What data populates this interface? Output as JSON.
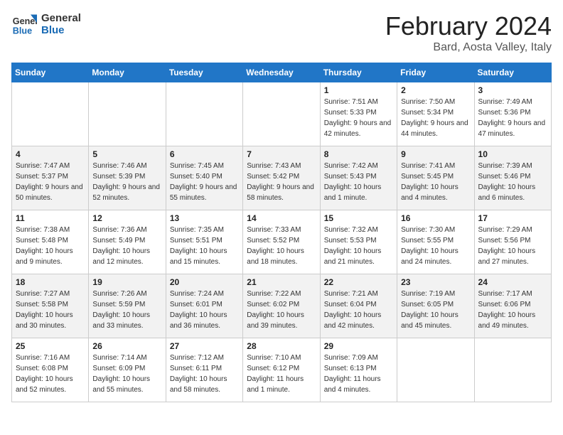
{
  "header": {
    "logo_line1": "General",
    "logo_line2": "Blue",
    "month_title": "February 2024",
    "location": "Bard, Aosta Valley, Italy"
  },
  "days_of_week": [
    "Sunday",
    "Monday",
    "Tuesday",
    "Wednesday",
    "Thursday",
    "Friday",
    "Saturday"
  ],
  "weeks": [
    [
      {
        "day": "",
        "info": ""
      },
      {
        "day": "",
        "info": ""
      },
      {
        "day": "",
        "info": ""
      },
      {
        "day": "",
        "info": ""
      },
      {
        "day": "1",
        "info": "Sunrise: 7:51 AM\nSunset: 5:33 PM\nDaylight: 9 hours and 42 minutes."
      },
      {
        "day": "2",
        "info": "Sunrise: 7:50 AM\nSunset: 5:34 PM\nDaylight: 9 hours and 44 minutes."
      },
      {
        "day": "3",
        "info": "Sunrise: 7:49 AM\nSunset: 5:36 PM\nDaylight: 9 hours and 47 minutes."
      }
    ],
    [
      {
        "day": "4",
        "info": "Sunrise: 7:47 AM\nSunset: 5:37 PM\nDaylight: 9 hours and 50 minutes."
      },
      {
        "day": "5",
        "info": "Sunrise: 7:46 AM\nSunset: 5:39 PM\nDaylight: 9 hours and 52 minutes."
      },
      {
        "day": "6",
        "info": "Sunrise: 7:45 AM\nSunset: 5:40 PM\nDaylight: 9 hours and 55 minutes."
      },
      {
        "day": "7",
        "info": "Sunrise: 7:43 AM\nSunset: 5:42 PM\nDaylight: 9 hours and 58 minutes."
      },
      {
        "day": "8",
        "info": "Sunrise: 7:42 AM\nSunset: 5:43 PM\nDaylight: 10 hours and 1 minute."
      },
      {
        "day": "9",
        "info": "Sunrise: 7:41 AM\nSunset: 5:45 PM\nDaylight: 10 hours and 4 minutes."
      },
      {
        "day": "10",
        "info": "Sunrise: 7:39 AM\nSunset: 5:46 PM\nDaylight: 10 hours and 6 minutes."
      }
    ],
    [
      {
        "day": "11",
        "info": "Sunrise: 7:38 AM\nSunset: 5:48 PM\nDaylight: 10 hours and 9 minutes."
      },
      {
        "day": "12",
        "info": "Sunrise: 7:36 AM\nSunset: 5:49 PM\nDaylight: 10 hours and 12 minutes."
      },
      {
        "day": "13",
        "info": "Sunrise: 7:35 AM\nSunset: 5:51 PM\nDaylight: 10 hours and 15 minutes."
      },
      {
        "day": "14",
        "info": "Sunrise: 7:33 AM\nSunset: 5:52 PM\nDaylight: 10 hours and 18 minutes."
      },
      {
        "day": "15",
        "info": "Sunrise: 7:32 AM\nSunset: 5:53 PM\nDaylight: 10 hours and 21 minutes."
      },
      {
        "day": "16",
        "info": "Sunrise: 7:30 AM\nSunset: 5:55 PM\nDaylight: 10 hours and 24 minutes."
      },
      {
        "day": "17",
        "info": "Sunrise: 7:29 AM\nSunset: 5:56 PM\nDaylight: 10 hours and 27 minutes."
      }
    ],
    [
      {
        "day": "18",
        "info": "Sunrise: 7:27 AM\nSunset: 5:58 PM\nDaylight: 10 hours and 30 minutes."
      },
      {
        "day": "19",
        "info": "Sunrise: 7:26 AM\nSunset: 5:59 PM\nDaylight: 10 hours and 33 minutes."
      },
      {
        "day": "20",
        "info": "Sunrise: 7:24 AM\nSunset: 6:01 PM\nDaylight: 10 hours and 36 minutes."
      },
      {
        "day": "21",
        "info": "Sunrise: 7:22 AM\nSunset: 6:02 PM\nDaylight: 10 hours and 39 minutes."
      },
      {
        "day": "22",
        "info": "Sunrise: 7:21 AM\nSunset: 6:04 PM\nDaylight: 10 hours and 42 minutes."
      },
      {
        "day": "23",
        "info": "Sunrise: 7:19 AM\nSunset: 6:05 PM\nDaylight: 10 hours and 45 minutes."
      },
      {
        "day": "24",
        "info": "Sunrise: 7:17 AM\nSunset: 6:06 PM\nDaylight: 10 hours and 49 minutes."
      }
    ],
    [
      {
        "day": "25",
        "info": "Sunrise: 7:16 AM\nSunset: 6:08 PM\nDaylight: 10 hours and 52 minutes."
      },
      {
        "day": "26",
        "info": "Sunrise: 7:14 AM\nSunset: 6:09 PM\nDaylight: 10 hours and 55 minutes."
      },
      {
        "day": "27",
        "info": "Sunrise: 7:12 AM\nSunset: 6:11 PM\nDaylight: 10 hours and 58 minutes."
      },
      {
        "day": "28",
        "info": "Sunrise: 7:10 AM\nSunset: 6:12 PM\nDaylight: 11 hours and 1 minute."
      },
      {
        "day": "29",
        "info": "Sunrise: 7:09 AM\nSunset: 6:13 PM\nDaylight: 11 hours and 4 minutes."
      },
      {
        "day": "",
        "info": ""
      },
      {
        "day": "",
        "info": ""
      }
    ]
  ]
}
